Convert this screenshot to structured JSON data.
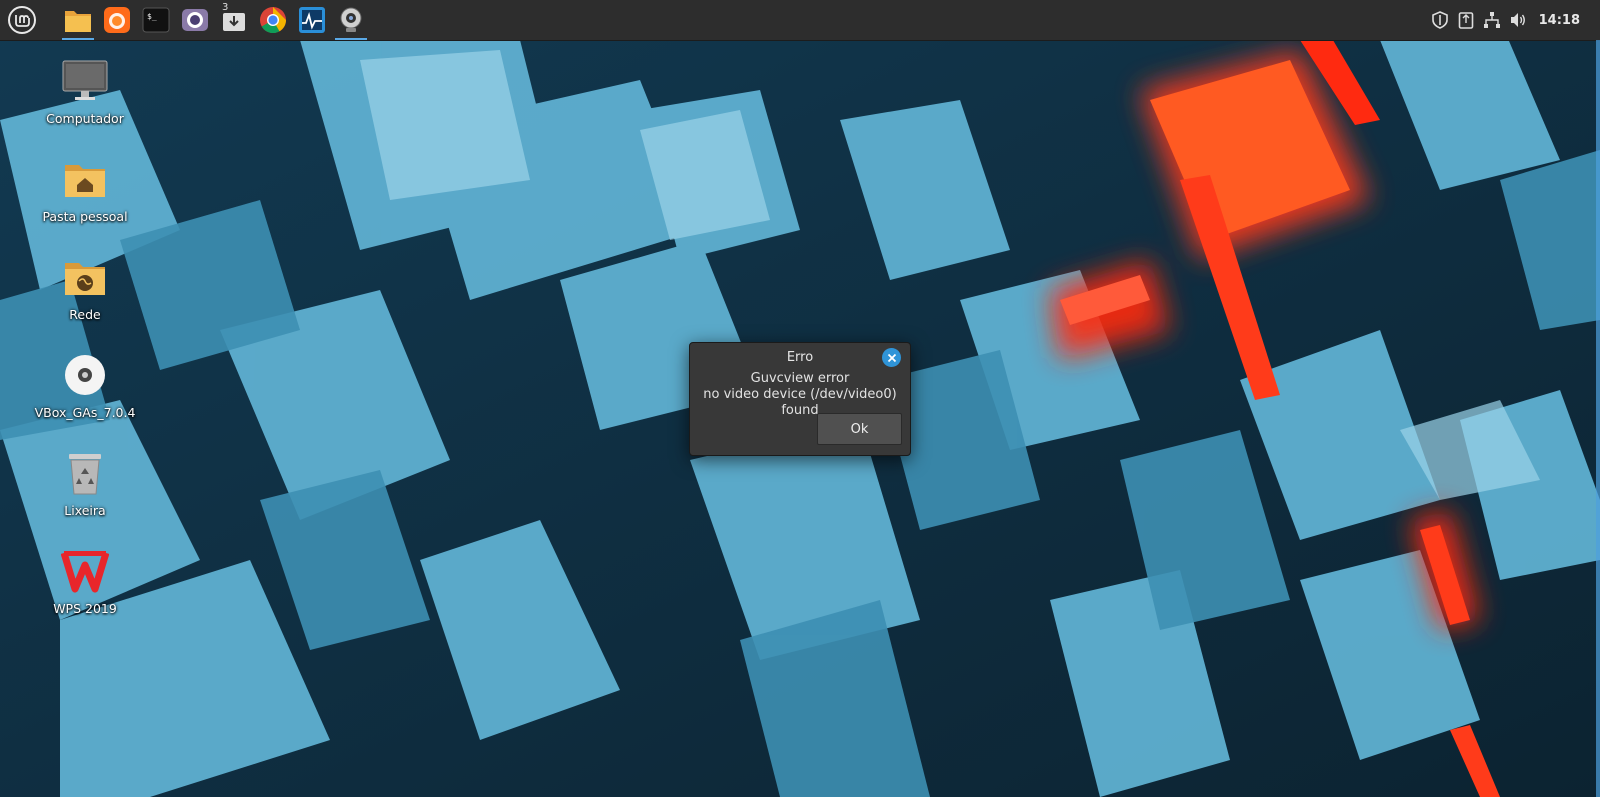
{
  "panel": {
    "menu_icon": "linux-mint-logo-icon",
    "launchers": [
      {
        "name": "files-icon",
        "active": true
      },
      {
        "name": "firefox-icon",
        "active": false
      },
      {
        "name": "terminal-icon",
        "active": false
      },
      {
        "name": "camera-app-icon",
        "active": false
      },
      {
        "name": "update-manager-icon",
        "active": false,
        "badge": "3"
      },
      {
        "name": "chrome-icon",
        "active": false
      },
      {
        "name": "system-monitor-icon",
        "active": false
      },
      {
        "name": "guvcview-webcam-icon",
        "active": true
      }
    ],
    "terminal_glyph": "$_",
    "tray": [
      "shield-icon",
      "clipboard-icon",
      "network-icon",
      "volume-icon"
    ],
    "clock": "14:18"
  },
  "desktop": {
    "icons": [
      {
        "label": "Computador",
        "icon": "monitor-icon"
      },
      {
        "label": "Pasta pessoal",
        "icon": "home-folder-icon"
      },
      {
        "label": "Rede",
        "icon": "network-folder-icon"
      },
      {
        "label": "VBox_GAs_7.0.4",
        "icon": "disc-icon"
      },
      {
        "label": "Lixeira",
        "icon": "trash-icon"
      },
      {
        "label": "WPS 2019",
        "icon": "wps-office-icon"
      }
    ]
  },
  "dialog": {
    "title": "Erro",
    "line1": "Guvcview error",
    "line2": "no video device (/dev/video0) found",
    "ok_label": "Ok"
  },
  "colors": {
    "panel": "#2d2d2d",
    "accent": "#2f94d8",
    "wallpaper_dark": "#0e2a3b",
    "wallpaper_light": "#5fb0d1",
    "wallpaper_glow": "#ff3a1e"
  }
}
